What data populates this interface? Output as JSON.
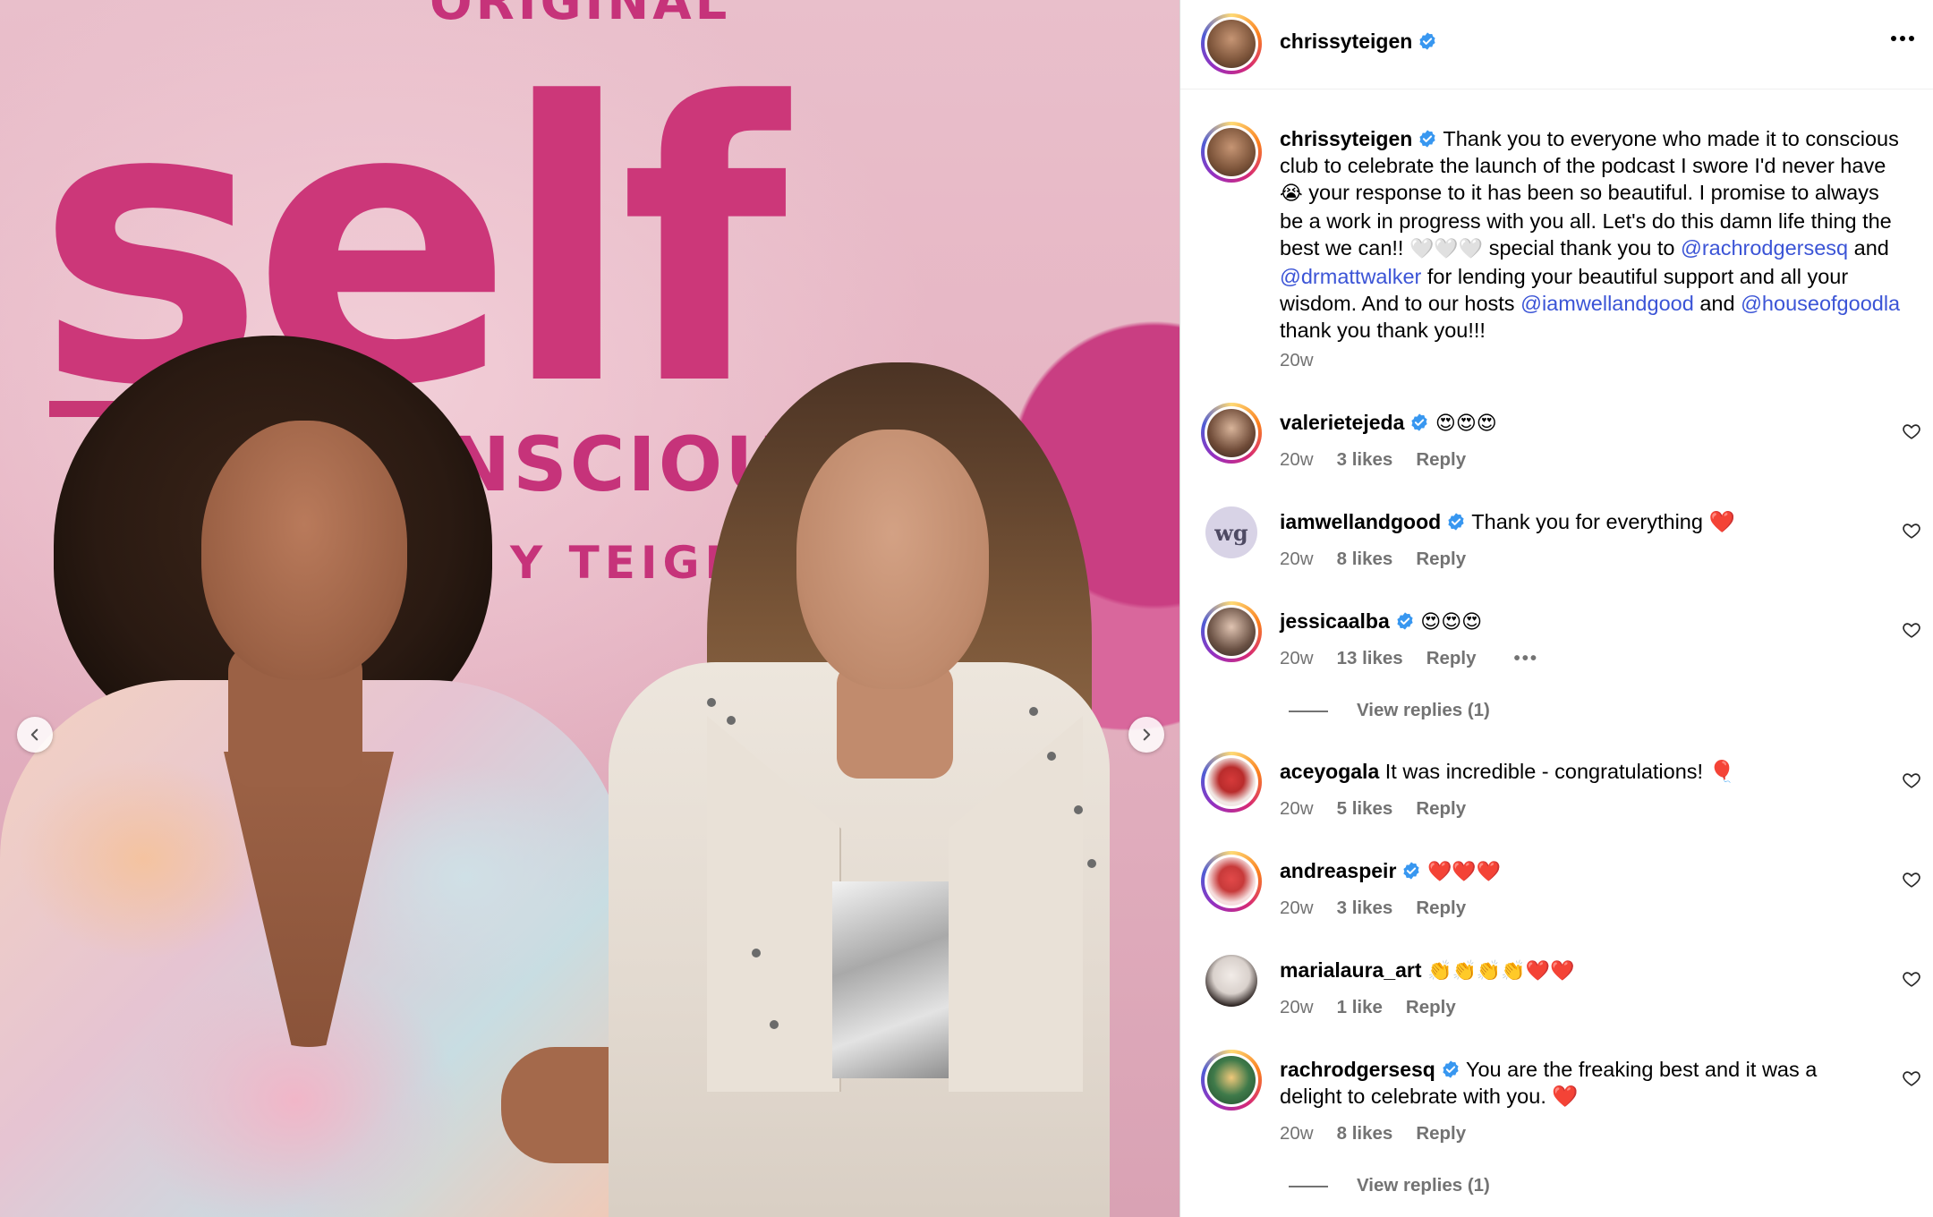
{
  "photo": {
    "brand_top": "ORIGINAL",
    "brand_title": "self",
    "brand_sub": "NSCIOUS",
    "brand_by": "Y TEIGEN",
    "nav_prev": "previous",
    "nav_next": "next"
  },
  "post": {
    "username": "chrissyteigen",
    "more_icon": "•••",
    "caption": {
      "username": "chrissyteigen",
      "p1": "Thank you to everyone who made it to conscious club to celebrate the launch of the podcast I swore I'd never have ",
      "e1": "😭",
      "p2": " your response to it has been so beautiful. I promise to always be a work in progress with you all. Let's do this damn life thing the best we can!! ",
      "e2": "🤍🤍🤍",
      "p3": " special thank you to ",
      "m1": "@rachrodgersesq",
      "p4": " and ",
      "m2": "@drmattwalker",
      "p5": " for lending your beautiful support and all your wisdom. And to our hosts ",
      "m3": "@iamwellandgood",
      "p6": " and ",
      "m4": "@houseofgoodla",
      "p7": " thank you thank you!!!",
      "time": "20w"
    },
    "comments": [
      {
        "user": "valerietejeda",
        "verified": true,
        "text": "😍😍😍",
        "time": "20w",
        "likes": "3 likes",
        "reply": "Reply"
      },
      {
        "user": "iamwellandgood",
        "verified": true,
        "text": "Thank you for everything ❤️",
        "time": "20w",
        "likes": "8 likes",
        "reply": "Reply",
        "avatar_text": "wg"
      },
      {
        "user": "jessicaalba",
        "verified": true,
        "text": "😍😍😍",
        "time": "20w",
        "likes": "13 likes",
        "reply": "Reply",
        "more": "•••",
        "view_replies": "View replies (1)"
      },
      {
        "user": "aceyogala",
        "verified": false,
        "text": "It was incredible - congratulations! 🎈",
        "time": "20w",
        "likes": "5 likes",
        "reply": "Reply"
      },
      {
        "user": "andreaspeir",
        "verified": true,
        "text": "❤️❤️❤️",
        "time": "20w",
        "likes": "3 likes",
        "reply": "Reply"
      },
      {
        "user": "marialaura_art",
        "verified": false,
        "text": "👏👏👏👏❤️❤️",
        "time": "20w",
        "likes": "1 like",
        "reply": "Reply"
      },
      {
        "user": "rachrodgersesq",
        "verified": true,
        "text": "You are the freaking best and it was a delight to celebrate with you. ❤️",
        "time": "20w",
        "likes": "8 likes",
        "reply": "Reply",
        "view_replies": "View replies (1)"
      }
    ]
  },
  "colors": {
    "brand_pink": "#cc3779",
    "mention_blue": "#3b54d6",
    "verified_blue": "#3897f0",
    "meta_gray": "#737373"
  }
}
